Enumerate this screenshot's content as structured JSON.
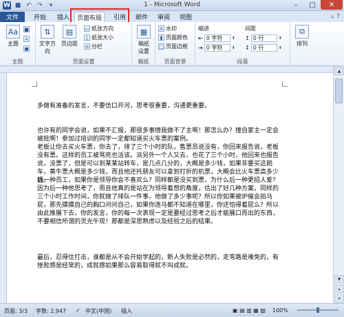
{
  "window": {
    "title": "1 - Microsoft Word"
  },
  "tabs": [
    {
      "label": "文件"
    },
    {
      "label": "开始"
    },
    {
      "label": "插入"
    },
    {
      "label": "页面布局"
    },
    {
      "label": "引用"
    },
    {
      "label": "邮件"
    },
    {
      "label": "审阅"
    },
    {
      "label": "视图"
    }
  ],
  "ribbon": {
    "groups": {
      "theme": "主题",
      "page_setup": "页面设置",
      "draft": "稿纸",
      "page_bg": "页面背景",
      "paragraph": "段落"
    },
    "buttons": {
      "theme": "主题",
      "text_direction": "文字方向",
      "margins": "页边距",
      "orientation": "纸张方向",
      "size": "纸张大小",
      "columns": "分栏",
      "draft_settings": "稿纸\n设置",
      "watermark": "水印",
      "page_color": "页面颜色",
      "page_border": "页面边框",
      "arrange": "排列"
    },
    "indent": {
      "label": "缩进",
      "left_value": "0 字符",
      "right_value": "0 字符"
    },
    "spacing": {
      "label": "间距",
      "before_value": "0 行",
      "after_value": "0 行"
    }
  },
  "document": {
    "line1": "多做有准备的发言，不要信口开河，思考很重要，沟通更重要。",
    "para2": "也许有的同学会说，如果不汇报，那很多事情我做不了主啊！那怎么办？撞自家主一定会被批啊！参加过培训的同学一定都知道买火车票的案例。",
    "para3": "老板让你去买火车票，你去了，排了三个小时的队，售票员说没有，你回来报告说，老板没有票。这样的员工被骂死也活该。派另外一个人又去，也花了三个小时，他回来也报告说，没票了，但是可以到某某站转车，是几点几分的，大概是多少钱，如果非要买这趟车，黄牛票大概是多少钱，而且他还托朋友可以拿到打折的机票，大概会比火车票高多少钱。",
    "para4": "后一种员工，如果你是领导你会不喜欢么？同样都是没买到票，为什么后一种更招人爱？因为后一种他思考了，而且他真的是站在为领导着想的角度，估出了好几种方案，同样的三个小时工作时间，你就做了排队一件事，他做了多少事呢？所以你如果被炉催会拍马屁，那先摸摸自己的胸口问问自己，如果你连马都不知道在哪里，你还怕得着屁么？所以由此推展下去，你的发言，你的每一次表现一定是要经过思考之后才能展口而出的东西，不要相信所谓的灵光午现！那都是深思熟虑以及经验之后的结果。",
    "para5": "最后，忍得住打击，谁都是从不会开始学起的，新人失败是必然的，走弯路是难免的，有挫败感是经常的，成就感如果那么容易取得就不叫成就。"
  },
  "status": {
    "page": "页面: 3/3",
    "words": "字数: 2,947",
    "language": "中文(中国)",
    "mode": "插入",
    "zoom": "100%"
  }
}
